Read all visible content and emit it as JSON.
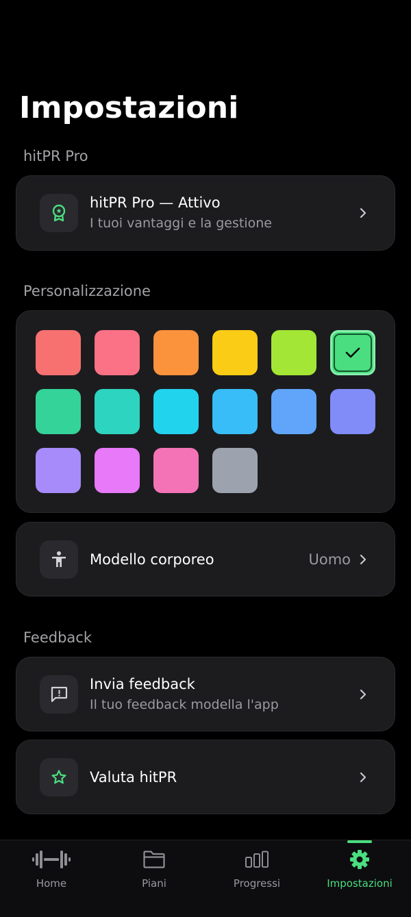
{
  "page": {
    "title": "Impostazioni"
  },
  "sections": {
    "pro": "hitPR Pro",
    "personalization": "Personalizzazione",
    "feedback": "Feedback"
  },
  "pro_card": {
    "title": "hitPR Pro — Attivo",
    "subtitle": "I tuoi vantaggi e la gestione",
    "icon": "award-badge-icon"
  },
  "colors": {
    "swatches": [
      "#f87171",
      "#fb7185",
      "#fb923c",
      "#facc15",
      "#a3e635",
      "#4ade80",
      "#34d399",
      "#2dd4bf",
      "#22d3ee",
      "#38bdf8",
      "#60a5fa",
      "#818cf8",
      "#a78bfa",
      "#e879f9",
      "#f472b6",
      "#9ca3af"
    ],
    "selected_index": 5
  },
  "body_model": {
    "label": "Modello corporeo",
    "value": "Uomo",
    "icon": "person-icon"
  },
  "send_feedback": {
    "title": "Invia feedback",
    "subtitle": "Il tuo feedback modella l'app",
    "icon": "feedback-icon"
  },
  "rate": {
    "title": "Valuta hitPR",
    "icon": "star-icon"
  },
  "tabs": [
    {
      "label": "Home",
      "icon": "dumbbell-icon",
      "active": false
    },
    {
      "label": "Piani",
      "icon": "folder-icon",
      "active": false
    },
    {
      "label": "Progressi",
      "icon": "bar-chart-icon",
      "active": false
    },
    {
      "label": "Impostazioni",
      "icon": "gear-icon",
      "active": true
    }
  ],
  "accent": "#4ade80"
}
